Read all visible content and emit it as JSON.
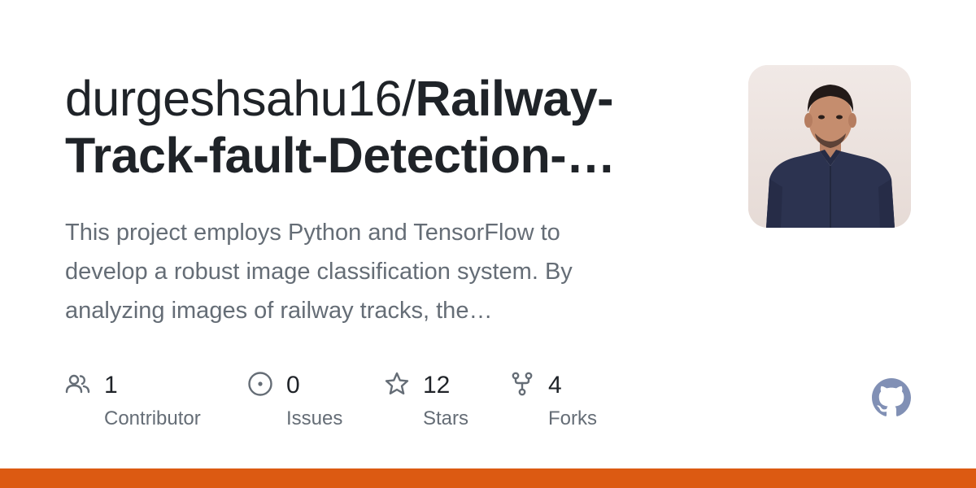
{
  "repo": {
    "owner_prefix": "durgeshsahu16/",
    "name_line1": "Railway-",
    "name_line2": "Track-fault-Detection-…",
    "description_lines": [
      "This project employs Python and TensorFlow to",
      "develop a robust image classification system. By",
      "analyzing images of railway tracks, the…"
    ]
  },
  "stats": [
    {
      "icon": "people-icon",
      "count": "1",
      "label": "Contributor"
    },
    {
      "icon": "issue-icon",
      "count": "0",
      "label": "Issues"
    },
    {
      "icon": "star-icon",
      "count": "12",
      "label": "Stars"
    },
    {
      "icon": "fork-icon",
      "count": "4",
      "label": "Forks"
    }
  ],
  "colors": {
    "title": "#1f2328",
    "muted": "#656d76",
    "icon": "#656d76",
    "github_logo": "#8190b5",
    "language_bar": "#dc5a12"
  }
}
